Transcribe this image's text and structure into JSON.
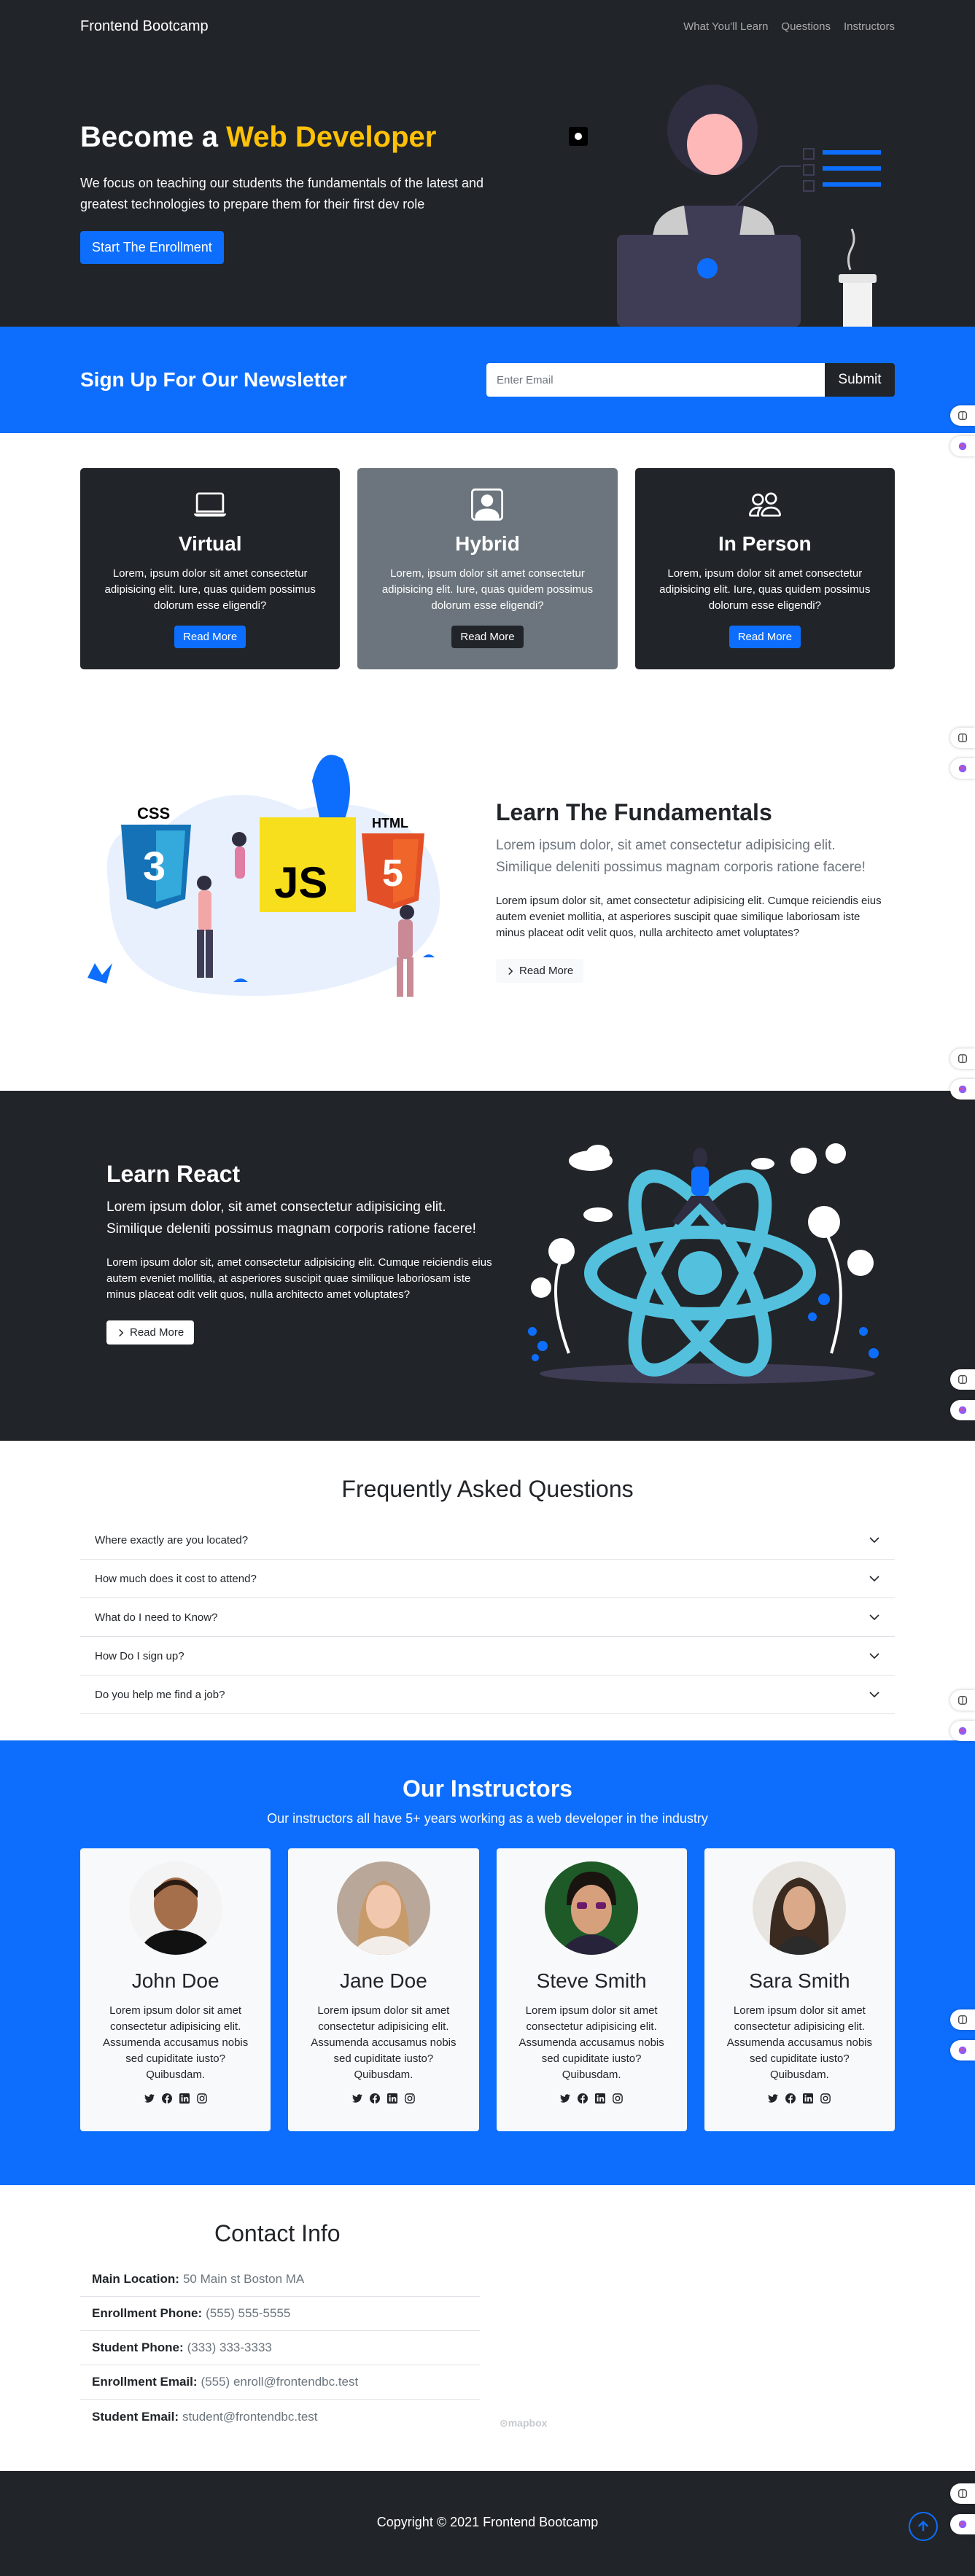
{
  "nav": {
    "brand": "Frontend Bootcamp",
    "links": [
      "What You'll Learn",
      "Questions",
      "Instructors"
    ]
  },
  "hero": {
    "title_prefix": "Become a ",
    "title_highlight": "Web Developer",
    "subtitle": "We focus on teaching our students the fundamentals of the latest and greatest technologies to prepare them for their first dev role",
    "cta": "Start The Enrollment"
  },
  "newsletter": {
    "title": "Sign Up For Our Newsletter",
    "placeholder": "Enter Email",
    "submit": "Submit"
  },
  "cards": [
    {
      "title": "Virtual",
      "text": "Lorem, ipsum dolor sit amet consectetur adipisicing elit. Iure, quas quidem possimus dolorum esse eligendi?",
      "button": "Read More",
      "icon": "laptop-icon"
    },
    {
      "title": "Hybrid",
      "text": "Lorem, ipsum dolor sit amet consectetur adipisicing elit. Iure, quas quidem possimus dolorum esse eligendi?",
      "button": "Read More",
      "icon": "person-square-icon"
    },
    {
      "title": "In Person",
      "text": "Lorem, ipsum dolor sit amet consectetur adipisicing elit. Iure, quas quidem possimus dolorum esse eligendi?",
      "button": "Read More",
      "icon": "people-icon"
    }
  ],
  "fundamentals": {
    "title": "Learn The Fundamentals",
    "lead": "Lorem ipsum dolor, sit amet consectetur adipisicing elit. Similique deleniti possimus magnam corporis ratione facere!",
    "text": "Lorem ipsum dolor sit, amet consectetur adipisicing elit. Cumque reiciendis eius autem eveniet mollitia, at asperiores suscipit quae similique laboriosam iste minus placeat odit velit quos, nulla architecto amet voluptates?",
    "button": "Read More"
  },
  "react": {
    "title": "Learn React",
    "lead": "Lorem ipsum dolor, sit amet consectetur adipisicing elit. Similique deleniti possimus magnam corporis ratione facere!",
    "text": "Lorem ipsum dolor sit, amet consectetur adipisicing elit. Cumque reiciendis eius autem eveniet mollitia, at asperiores suscipit quae similique laboriosam iste minus placeat odit velit quos, nulla architecto amet voluptates?",
    "button": "Read More"
  },
  "faq": {
    "title": "Frequently Asked Questions",
    "items": [
      "Where exactly are you located?",
      "How much does it cost to attend?",
      "What do I need to Know?",
      "How Do I sign up?",
      "Do you help me find a job?"
    ]
  },
  "instructors": {
    "title": "Our Instructors",
    "subtitle": "Our instructors all have 5+ years working as a web developer in the industry",
    "people": [
      {
        "name": "John Doe",
        "bio": "Lorem ipsum dolor sit amet consectetur adipisicing elit. Assumenda accusamus nobis sed cupiditate iusto? Quibusdam."
      },
      {
        "name": "Jane Doe",
        "bio": "Lorem ipsum dolor sit amet consectetur adipisicing elit. Assumenda accusamus nobis sed cupiditate iusto? Quibusdam."
      },
      {
        "name": "Steve Smith",
        "bio": "Lorem ipsum dolor sit amet consectetur adipisicing elit. Assumenda accusamus nobis sed cupiditate iusto? Quibusdam."
      },
      {
        "name": "Sara Smith",
        "bio": "Lorem ipsum dolor sit amet consectetur adipisicing elit. Assumenda accusamus nobis sed cupiditate iusto? Quibusdam."
      }
    ]
  },
  "contact": {
    "title": "Contact Info",
    "items": [
      {
        "label": "Main Location:",
        "value": "50 Main st Boston MA"
      },
      {
        "label": "Enrollment Phone:",
        "value": "(555) 555-5555"
      },
      {
        "label": "Student Phone:",
        "value": "(333) 333-3333"
      },
      {
        "label": "Enrollment Email:",
        "value": "(555) enroll@frontendbc.test"
      },
      {
        "label": "Student Email:",
        "value": "student@frontendbc.test"
      }
    ],
    "map_credit": "mapbox"
  },
  "footer": {
    "copyright": "Copyright © 2021 Frontend Bootcamp"
  },
  "colors": {
    "dark": "#212529",
    "primary": "#0d6efd",
    "warning": "#ffc107",
    "secondary": "#6c757d",
    "light": "#f8f9fa"
  }
}
